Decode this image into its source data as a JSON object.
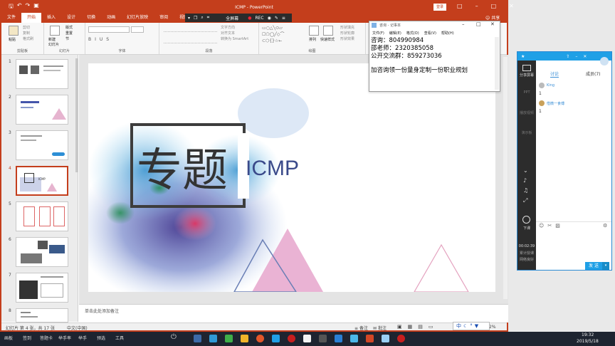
{
  "titlebar": {
    "title": "ICMP  -  PowerPoint",
    "login": "登录",
    "quick_access": [
      "save-icon",
      "undo-icon",
      "redo-icon",
      "present-icon"
    ]
  },
  "menubar": {
    "tabs": [
      "文件",
      "开始",
      "插入",
      "设计",
      "切换",
      "动画",
      "幻灯片放映",
      "审阅",
      "视图",
      "帮助"
    ],
    "active": "开始",
    "share": "共享"
  },
  "recorder": {
    "fullscreen": "全屏幕",
    "rec": "REC"
  },
  "ribbon": {
    "groups": [
      "剪贴板",
      "幻灯片",
      "字体",
      "段落",
      "绘图",
      "编辑"
    ],
    "paste": "粘贴",
    "new_slide": "新建\n幻灯片",
    "layout": "版式",
    "reset": "重置",
    "section": "节",
    "cut": "剪切",
    "copy": "复制",
    "format_painter": "格式刷",
    "text_direction": "文字方向",
    "align_text": "对齐文本",
    "smartart": "转换为 SmartArt",
    "arrange": "排列",
    "quick_styles": "快速样式",
    "shape_fill": "形状填充",
    "shape_outline": "形状轮廓",
    "shape_effects": "形状效果",
    "find": "查找",
    "replace": "替换",
    "select": "选择"
  },
  "thumbnails": [
    {
      "num": "1"
    },
    {
      "num": "2"
    },
    {
      "num": "3"
    },
    {
      "num": "4"
    },
    {
      "num": "5"
    },
    {
      "num": "6"
    },
    {
      "num": "7"
    },
    {
      "num": "8"
    }
  ],
  "selected_thumbnail": "4",
  "slide": {
    "title_cn": "专题",
    "title_en": "ICMP"
  },
  "notes_placeholder": "单击此处添加备注",
  "statusbar": {
    "slide_info": "幻灯片 第 4 张，共 17 张",
    "language": "中文(中国)",
    "notes": "备注",
    "comments": "批注",
    "zoom": "2%"
  },
  "notepad": {
    "title": "咨询 - 记事本",
    "menu": [
      "文件(F)",
      "编辑(E)",
      "格式(O)",
      "查看(V)",
      "帮助(H)"
    ],
    "lines": [
      "咨询：804990984",
      "邵老师：2320385058",
      "公开交流群：859273036",
      "",
      "加咨询领一份量身定制一份职业规划"
    ]
  },
  "ime": {
    "text": "中"
  },
  "qq": {
    "share_screen": "分享屏幕",
    "side_items": [
      "PPT",
      "播放视频",
      "演示板"
    ],
    "tabs": [
      "讨论",
      "成员(7)"
    ],
    "messages": [
      {
        "name": "King",
        "text": "1"
      },
      {
        "name": "借微一食傅",
        "text": "1"
      }
    ],
    "hangup": "下课",
    "time": "00:02:39",
    "side_bottom": [
      "累计授课",
      "网络良好"
    ],
    "send": "发 送"
  },
  "taskbar": {
    "items": [
      "画板",
      "签到",
      "答题卡",
      "举手率",
      "举手",
      "预选",
      "工具"
    ],
    "time": "19:32",
    "date": "2019/5/18"
  }
}
